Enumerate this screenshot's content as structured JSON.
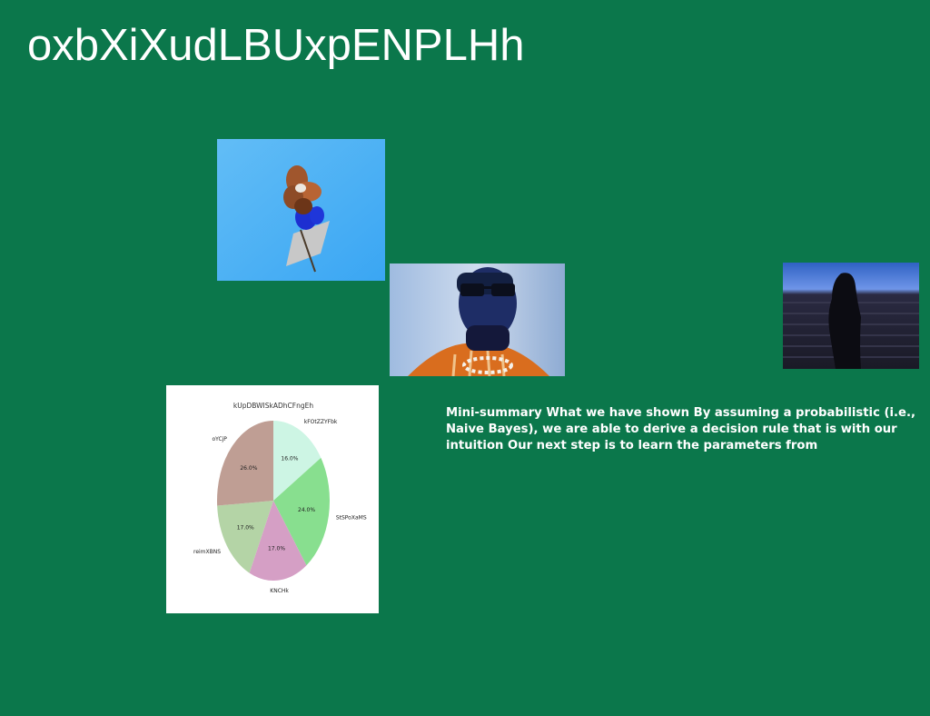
{
  "slide": {
    "title": "oxbXiXudLBUxpENPLHh",
    "summary": "Mini-summary What we have shown By assuming a probabilistic (i.e., Naive Bayes), we are able to derive a decision rule that is with our intuition Our next step is to learn the parameters from"
  },
  "images": {
    "flower": "photo-flower-on-paper",
    "man": "photo-man-sunglasses",
    "shadow": "photo-silhouette-by-water"
  },
  "chart_data": {
    "type": "pie",
    "title": "kUpDBWISkADhCFngEh",
    "slices": [
      {
        "label": "kFOtZZYFbk",
        "value": 16.0,
        "pct_label": "16.0%",
        "color": "#cdf5e4"
      },
      {
        "label": "StSPoXaMS",
        "value": 24.0,
        "pct_label": "24.0%",
        "color": "#88df8f"
      },
      {
        "label": "KNCHk",
        "value": 17.0,
        "pct_label": "17.0%",
        "color": "#d59fc5"
      },
      {
        "label": "reimXBNS",
        "value": 17.0,
        "pct_label": "17.0%",
        "color": "#b4d4a6"
      },
      {
        "label": "oYCjP",
        "value": 26.0,
        "pct_label": "26.0%",
        "color": "#bf9e94"
      }
    ]
  }
}
